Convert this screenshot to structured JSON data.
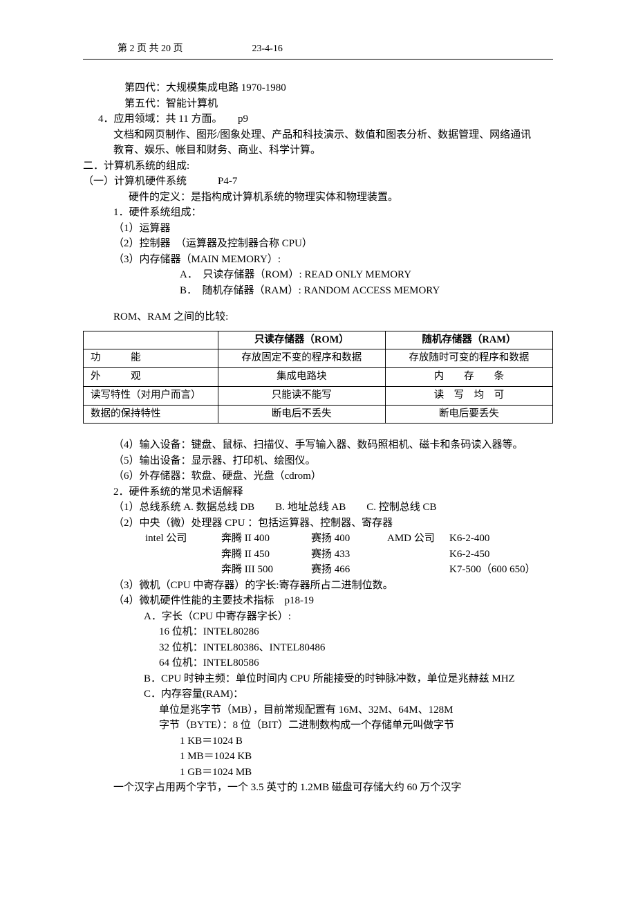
{
  "header": {
    "page_label": "第 2 页 共 20 页",
    "date": "23-4-16"
  },
  "top": {
    "gen4": "第四代：大规模集成电路 1970-1980",
    "gen5": "第五代：智能计算机",
    "item4": "4．应用领域：共 11 方面。　　p9",
    "item4_line1": "文档和网页制作、图形/图象处理、产品和科技演示、数值和图表分析、数据管理、网络通讯",
    "item4_line2": "教育、娱乐、帐目和财务、商业、科学计算。"
  },
  "sec2": {
    "title": "二．计算机系统的组成:",
    "sub1": "（一）计算机硬件系统　　　P4-7",
    "hw_def": "硬件的定义：是指构成计算机系统的物理实体和物理装置。",
    "hw1": "1．硬件系统组成：",
    "hw1_1": "（1）运算器",
    "hw1_2": "（2）控制器　（运算器及控制器合称 CPU）",
    "hw1_3": "（3）内存储器（MAIN MEMORY）:",
    "hw1_3a": "A．　只读存储器（ROM）: READ ONLY MEMORY",
    "hw1_3b": "B．　随机存储器（RAM）: RANDOM ACCESS MEMORY",
    "rom_ram_title": "ROM、RAM 之间的比较:"
  },
  "table": {
    "h0": "",
    "h1": "只读存储器（ROM）",
    "h2": "随机存储器（RAM）",
    "rows": [
      {
        "c0": "功　　　能",
        "c1": "存放固定不变的程序和数据",
        "c2": "存放随时可变的程序和数据"
      },
      {
        "c0": "外　　　观",
        "c1": "集成电路块",
        "c2": "内　　存　　条"
      },
      {
        "c0": "读写特性（对用户而言）",
        "c1": "只能读不能写",
        "c2": "读　写　均　可"
      },
      {
        "c0": "数据的保持特性",
        "c1": "断电后不丢失",
        "c2": "断电后要丢失"
      }
    ]
  },
  "after_table": {
    "i4": "（4）输入设备：键盘、鼠标、扫描仪、手写输入器、数码照相机、磁卡和条码读入器等。",
    "i5": "（5）输出设备：显示器、打印机、绘图仪。",
    "i6": "（6）外存储器：软盘、硬盘、光盘（cdrom）",
    "hw2": "2．硬件系统的常见术语解释",
    "hw2_1": "（1）总线系统 A. 数据总线 DB　　B. 地址总线 AB　　C. 控制总线 CB",
    "hw2_2": "（2）中央（微）处理器 CPU ：包括运算器、控制器、寄存器",
    "cpu": {
      "r1": [
        "intel 公司",
        "奔腾 II 400",
        "赛扬 400",
        "AMD 公司",
        "K6-2-400"
      ],
      "r2": [
        "",
        "奔腾 II 450",
        "赛扬 433",
        "",
        "K6-2-450"
      ],
      "r3": [
        "",
        "奔腾 III 500",
        "赛扬 466",
        "",
        "K7-500（600 650）"
      ]
    },
    "hw2_3": "（3）微机（CPU 中寄存器）的字长:寄存器所占二进制位数。",
    "hw2_4": "（4）微机硬件性能的主要技术指标　p18-19",
    "hw2_4a": "A．字长（CPU 中寄存器字长）:",
    "hw2_4a1": "16 位机：INTEL80286",
    "hw2_4a2": "32 位机：INTEL80386、INTEL80486",
    "hw2_4a3": "64 位机：INTEL80586",
    "hw2_4b": "B．CPU 时钟主频：单位时间内 CPU 所能接受的时钟脉冲数，单位是兆赫兹 MHZ",
    "hw2_4c": "C．内存容量(RAM)：",
    "hw2_4c1": "单位是兆字节（MB），目前常规配置有 16M、32M、64M、128M",
    "hw2_4c2": "字节（BYTE）：8 位（BIT）二进制数构成一个存储单元叫做字节",
    "hw2_4c3": "1 KB＝1024 B",
    "hw2_4c4": "1 MB＝1024 KB",
    "hw2_4c5": "1 GB＝1024 MB",
    "hw2_4_last": "一个汉字占用两个字节，一个 3.5 英寸的 1.2MB 磁盘可存储大约 60 万个汉字"
  }
}
